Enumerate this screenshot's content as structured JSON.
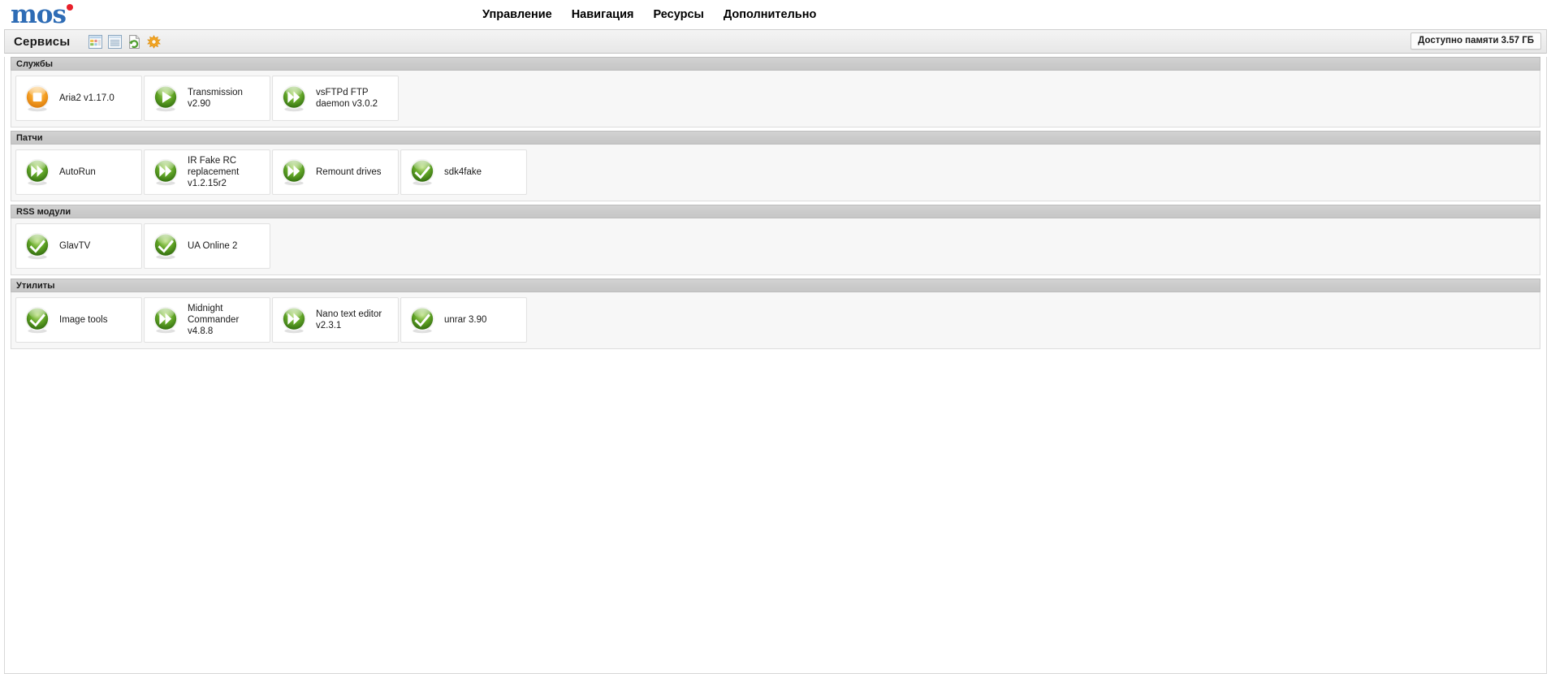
{
  "header": {
    "logo_text": "mos",
    "nav": [
      {
        "label": "Управление"
      },
      {
        "label": "Навигация"
      },
      {
        "label": "Ресурсы"
      },
      {
        "label": "Дополнительно"
      }
    ]
  },
  "toolbar": {
    "title": "Сервисы",
    "memory_badge": "Доступно памяти 3.57 ГБ",
    "icons": [
      {
        "name": "grid-view-icon",
        "label": "Вид плиткой"
      },
      {
        "name": "list-view-icon",
        "label": "Вид списком"
      },
      {
        "name": "refresh-page-icon",
        "label": "Обновить"
      },
      {
        "name": "settings-gear-icon",
        "label": "Настройки"
      }
    ]
  },
  "sections": [
    {
      "title": "Службы",
      "items": [
        {
          "label": "Aria2 v1.17.0",
          "icon": "stop-orange-icon"
        },
        {
          "label": "Transmission v2.90",
          "icon": "play-green-icon"
        },
        {
          "label": "vsFTPd FTP daemon v3.0.2",
          "icon": "forward-green-icon"
        }
      ]
    },
    {
      "title": "Патчи",
      "items": [
        {
          "label": "AutoRun",
          "icon": "forward-green-icon"
        },
        {
          "label": "IR Fake RC replacement v1.2.15r2",
          "icon": "forward-green-icon"
        },
        {
          "label": "Remount drives",
          "icon": "forward-green-icon"
        },
        {
          "label": "sdk4fake",
          "icon": "check-green-icon"
        }
      ]
    },
    {
      "title": "RSS модули",
      "items": [
        {
          "label": "GlavTV",
          "icon": "check-green-icon"
        },
        {
          "label": "UA Online 2",
          "icon": "check-green-icon"
        }
      ]
    },
    {
      "title": "Утилиты",
      "items": [
        {
          "label": "Image tools",
          "icon": "check-green-icon"
        },
        {
          "label": "Midnight Commander v4.8.8",
          "icon": "forward-green-icon"
        },
        {
          "label": "Nano text editor v2.3.1",
          "icon": "forward-green-icon"
        },
        {
          "label": "unrar 3.90",
          "icon": "check-green-icon"
        }
      ]
    }
  ],
  "colors": {
    "logo_blue": "#2e6cb5",
    "logo_dot_red": "#e8202a",
    "icon_green": "#5aa022",
    "icon_orange": "#f0941e",
    "section_header_gray": "#cbcbcb"
  }
}
